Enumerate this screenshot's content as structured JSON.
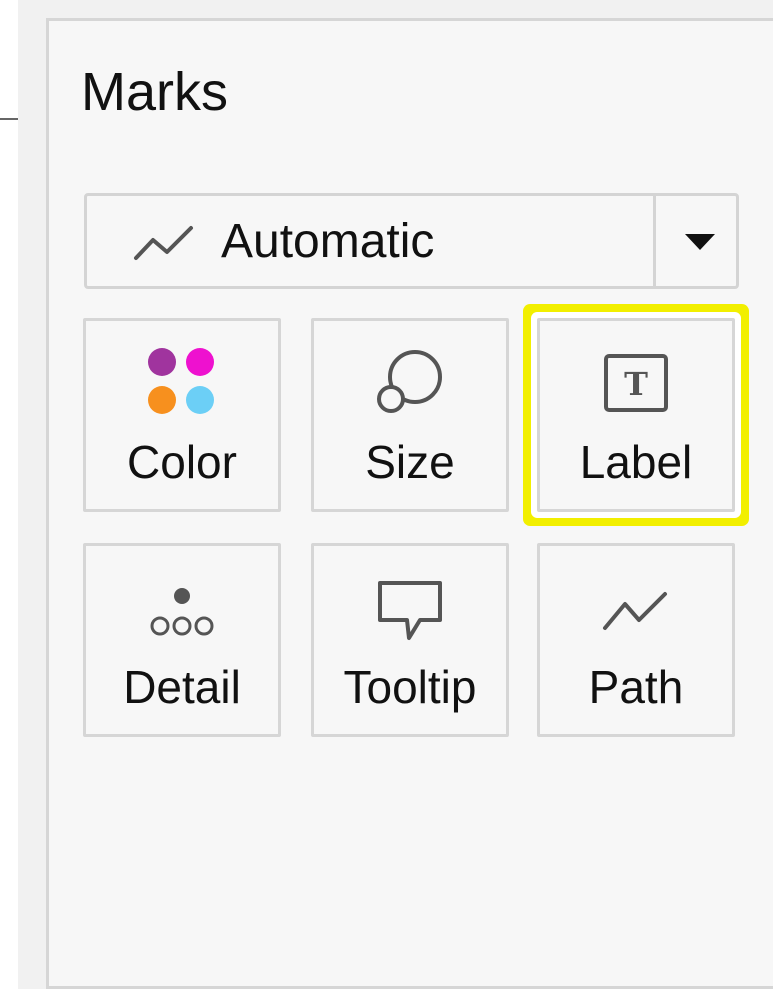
{
  "panel": {
    "title": "Marks"
  },
  "mark_type": {
    "icon": "line-chart-icon",
    "value": "Automatic",
    "dropdown_icon": "caret-down-icon"
  },
  "cards": [
    {
      "label": "Color",
      "icon": "color-dots-icon"
    },
    {
      "label": "Size",
      "icon": "size-circles-icon"
    },
    {
      "label": "Label",
      "icon": "text-label-icon",
      "highlighted": true
    },
    {
      "label": "Detail",
      "icon": "detail-dots-icon"
    },
    {
      "label": "Tooltip",
      "icon": "tooltip-bubble-icon"
    },
    {
      "label": "Path",
      "icon": "path-line-icon"
    }
  ],
  "colors": {
    "highlight": "#f2ef00",
    "color_dots": [
      "#a0349e",
      "#ee11cf",
      "#f7901e",
      "#6ccff6"
    ]
  }
}
